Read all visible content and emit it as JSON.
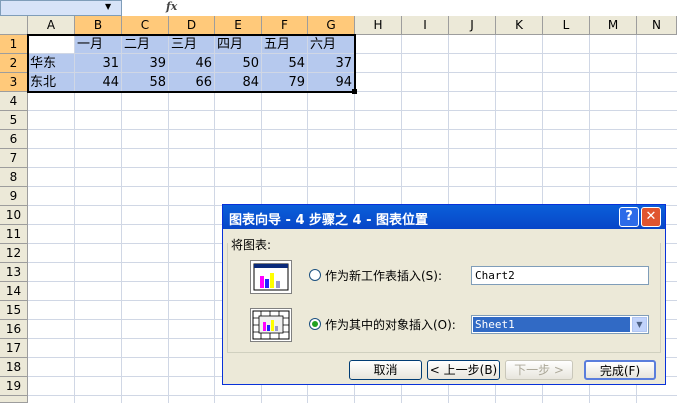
{
  "formula_bar": {
    "fx_label": "fx",
    "name_box_arrow": "▼"
  },
  "columns": [
    "A",
    "B",
    "C",
    "D",
    "E",
    "F",
    "G",
    "H",
    "I",
    "J",
    "K",
    "L",
    "M",
    "N"
  ],
  "rows": [
    "1",
    "2",
    "3",
    "4",
    "5",
    "6",
    "7",
    "8",
    "9",
    "10",
    "11",
    "12",
    "13",
    "14",
    "15",
    "16",
    "17",
    "18",
    "19",
    "20"
  ],
  "sheet": {
    "headers": [
      "一月",
      "二月",
      "三月",
      "四月",
      "五月",
      "六月"
    ],
    "row2": {
      "label": "华东",
      "values": [
        "31",
        "39",
        "46",
        "50",
        "54",
        "37"
      ]
    },
    "row3": {
      "label": "东北",
      "values": [
        "44",
        "58",
        "66",
        "84",
        "79",
        "94"
      ]
    }
  },
  "dialog": {
    "title": "图表向导 - 4 步骤之 4 - 图表位置",
    "help": "?",
    "close": "✕",
    "group_label": "将图表:",
    "option_new_sheet": "作为新工作表插入(S):",
    "new_sheet_value": "Chart2",
    "option_object": "作为其中的对象插入(O):",
    "object_value": "Sheet1",
    "dropdown_arrow": "▼",
    "btn_cancel": "取消",
    "btn_back": "< 上一步(B)",
    "btn_next": "下一步 >",
    "btn_finish": "完成(F)"
  }
}
